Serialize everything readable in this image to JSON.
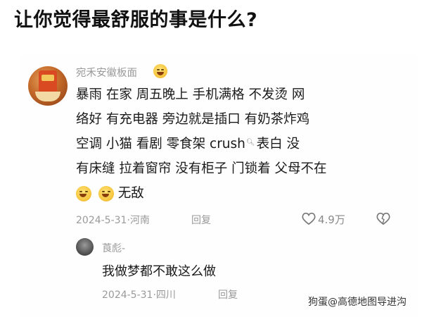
{
  "header": {
    "title": "让你觉得最舒服的事是什么?"
  },
  "comment": {
    "username": "宛禾安徽板面",
    "lines": [
      "暴雨 在家 周五晚上 手机满格 不发烫 网",
      "络好 有充电器 旁边就是插口 有奶茶炸鸡",
      "空调 小猫 看剧 零食架 crush",
      "表白 没",
      "有床缝 拉着窗帘 没有柜子 门锁着 父母不在",
      "无敌"
    ],
    "date_location": "2024-5-31·河南",
    "reply_label": "回复",
    "likes": "4.9万"
  },
  "reply": {
    "username": "莨彪-",
    "text": "我做梦都不敢这么做",
    "date_location": "2024-5-31·四川",
    "reply_label": "回复"
  },
  "watermark": "狗蛋@高德地图导进沟"
}
